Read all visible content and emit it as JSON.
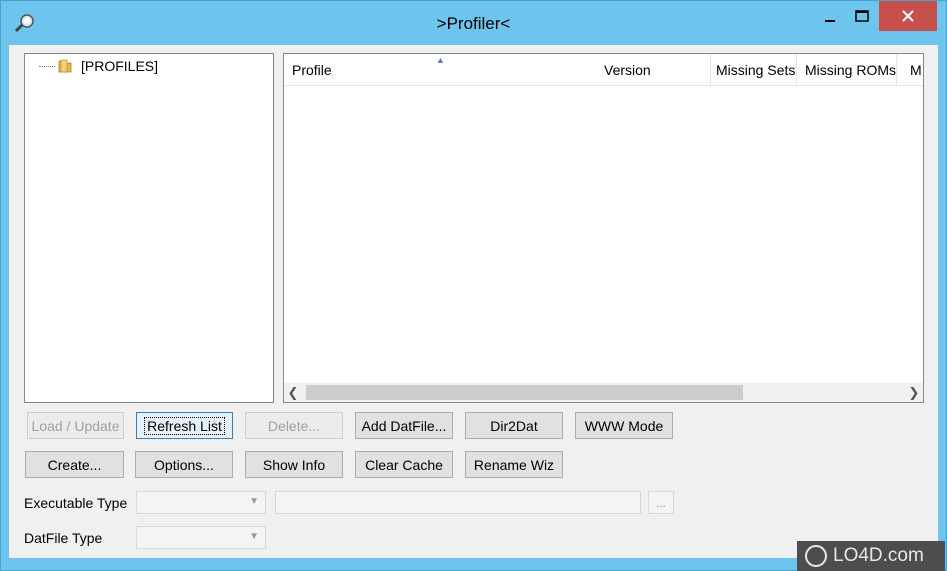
{
  "window": {
    "title": ">Profiler<"
  },
  "tree": {
    "root_label": "[PROFILES]"
  },
  "list": {
    "columns": [
      "Profile",
      "Version",
      "Missing Sets",
      "Missing ROMs",
      "M"
    ]
  },
  "buttons": {
    "load_update": "Load / Update",
    "refresh_list": "Refresh List",
    "delete": "Delete...",
    "add_datfile": "Add DatFile...",
    "dir2dat": "Dir2Dat",
    "www_mode": "WWW Mode",
    "create": "Create...",
    "options": "Options...",
    "show_info": "Show Info",
    "clear_cache": "Clear Cache",
    "rename_wiz": "Rename Wiz",
    "browse": "..."
  },
  "labels": {
    "executable_type": "Executable Type",
    "datfile_type": "DatFile Type"
  },
  "watermark": {
    "text": "LO4D.com"
  },
  "colors": {
    "titlebar": "#6dc4ec",
    "close": "#c7504f",
    "client": "#f0f0f0"
  }
}
